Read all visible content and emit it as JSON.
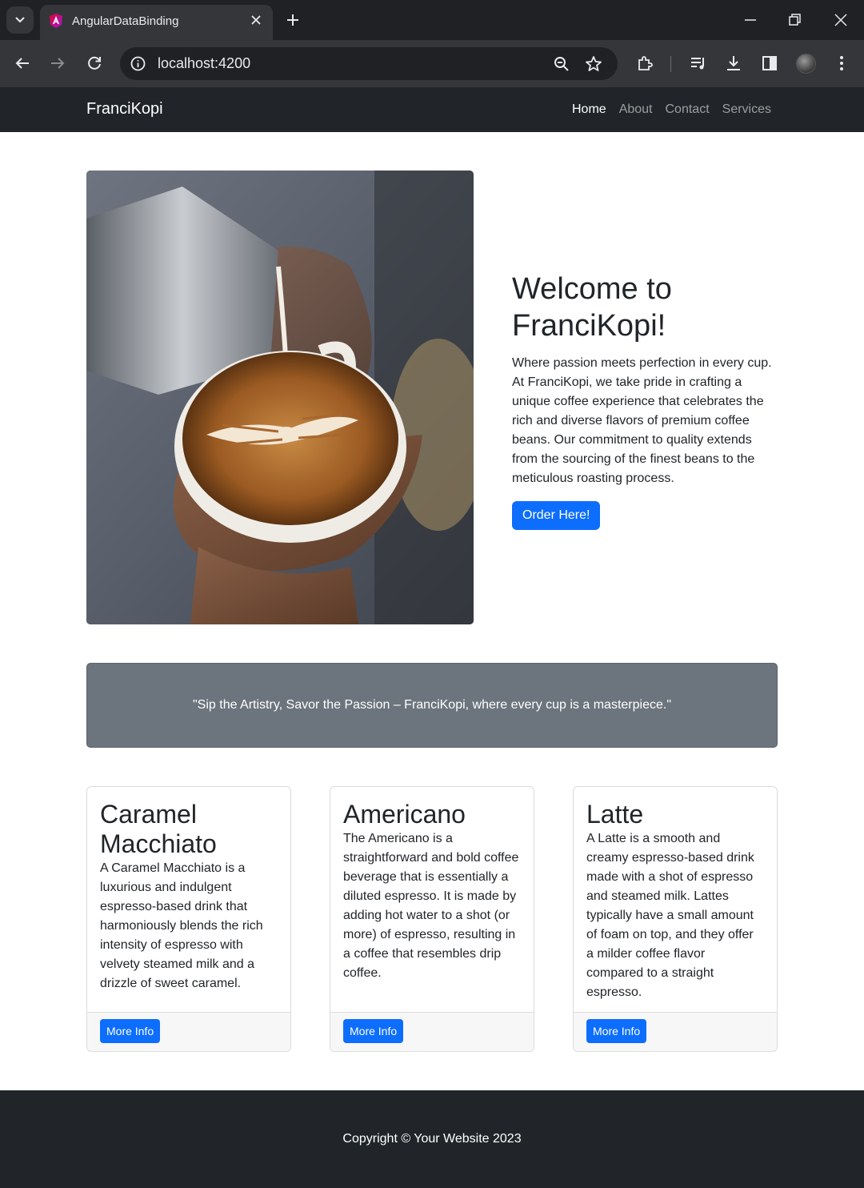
{
  "browser": {
    "tab_title": "AngularDataBinding",
    "url": "localhost:4200"
  },
  "navbar": {
    "brand": "FranciKopi",
    "links": [
      {
        "label": "Home",
        "active": true
      },
      {
        "label": "About",
        "active": false
      },
      {
        "label": "Contact",
        "active": false
      },
      {
        "label": "Services",
        "active": false
      }
    ]
  },
  "hero": {
    "image": "latte-art-pour-image",
    "title": "Welcome to FranciKopi!",
    "description": "Where passion meets perfection in every cup. At FranciKopi, we take pride in crafting a unique coffee experience that celebrates the rich and diverse flavors of premium coffee beans. Our commitment to quality extends from the sourcing of the finest beans to the meticulous roasting process.",
    "button": "Order Here!"
  },
  "quote": "\"Sip the Artistry, Savor the Passion – FranciKopi, where every cup is a masterpiece.\"",
  "cards": [
    {
      "title": "Caramel Macchiato",
      "text": "A Caramel Macchiato is a luxurious and indulgent espresso-based drink that harmoniously blends the rich intensity of espresso with velvety steamed milk and a drizzle of sweet caramel.",
      "button": "More Info"
    },
    {
      "title": "Americano",
      "text": "The Americano is a straightforward and bold coffee beverage that is essentially a diluted espresso. It is made by adding hot water to a shot (or more) of espresso, resulting in a coffee that resembles drip coffee.",
      "button": "More Info"
    },
    {
      "title": "Latte",
      "text": "A Latte is a smooth and creamy espresso-based drink made with a shot of espresso and steamed milk. Lattes typically have a small amount of foam on top, and they offer a milder coffee flavor compared to a straight espresso.",
      "button": "More Info"
    }
  ],
  "footer": "Copyright © Your Website 2023",
  "colors": {
    "primary": "#0d6efd",
    "dark": "#212529",
    "secondary": "#6c757d"
  }
}
